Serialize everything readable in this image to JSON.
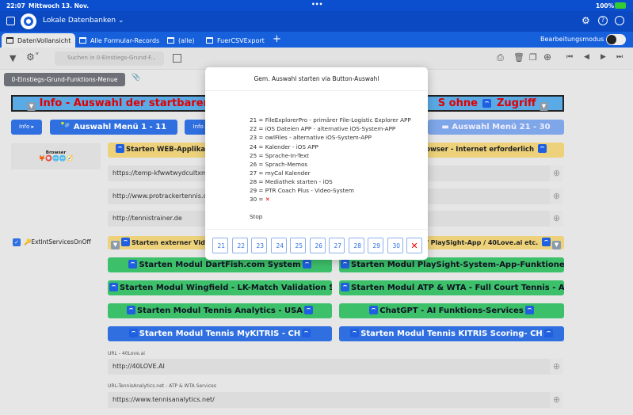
{
  "status": {
    "time": "22:07",
    "date": "Mittwoch 13. Nov.",
    "battery": "100%"
  },
  "header": {
    "title": "Lokale Datenbanken"
  },
  "tabs": [
    {
      "label": "DatenVollansicht"
    },
    {
      "label": "Alle Formular-Records"
    },
    {
      "label": "(alle)"
    },
    {
      "label": "FuerCSVExport"
    }
  ],
  "edit_mode_label": "Bearbeitungsmodus",
  "search_placeholder": "Suchen in 0-Einstiegs-Grund-F...",
  "chip": "0-Einstiegs-Grund-Funktions-Menue",
  "banner": {
    "left": "Info - Auswahl der startbaren i",
    "right": "S ohne",
    "right2": "Zugriff"
  },
  "buttons": {
    "info": "Info",
    "menu1": "Auswahl Menü 1 - 11",
    "menu3": "Auswahl Menü 21 - 30"
  },
  "browser_label": "Browser",
  "web_bar": {
    "left": "Starten WEB-Applikation(",
    "right": "andardBrowser - Internet erforderlich"
  },
  "urls": [
    "https://temp-kfwwtwydcultxmwa",
    "http://www.protrackertennis.com",
    "http://tennistrainer.de"
  ],
  "checkbox_label": "🔑ExtIntServicesOnOff",
  "video_bar": {
    "left": "Starten externer Video-Se",
    "right": "ish.com / PlaySight-App / 40Love.ai etc."
  },
  "modules": [
    "Starten Modul DartFish.com System",
    "Starten Modul PlaySight-System-App-Funktionen",
    "Starten Modul Wingfield - LK-Match Validation System",
    "Starten Modul ATP & WTA - Full Court Tennis - Analysis",
    "Starten Modul Tennis Analytics - USA",
    "ChatGPT - AI Funktions-Services",
    "Starten Modul Tennis MyKITRIS - CH",
    "Starten Modul Tennis KITRIS Scoring- CH"
  ],
  "fields": [
    {
      "label": "URL - 40Love.ai",
      "value": "http://40LOVE.AI"
    },
    {
      "label": "URL-TennisAnalytics.net - ATP & WTA Services",
      "value": "https://www.tennisanalytics.net/"
    }
  ],
  "modal": {
    "title": "Gem. Auswahl starten via Button-Auswahl",
    "lines": [
      "21 = FileExplorerPro - primärer File-Logistic Explorer APP",
      "22 = iOS Dateien APP - alternative iOS-System-APP",
      "23 = owlFiles - alternative iOS-System-APP",
      "24 = Kalender - iOS APP",
      "25 = Sprache-In-Text",
      "26 = Sprach-Memos",
      "27 = myCal Kalender",
      "28 = Mediathek starten - iOS",
      "29 = PTR Coach Plus - Video-System",
      "30 = "
    ],
    "stop": "Stop",
    "buttons": [
      "21",
      "22",
      "23",
      "24",
      "25",
      "26",
      "27",
      "28",
      "29",
      "30"
    ],
    "cancel": "✕"
  }
}
